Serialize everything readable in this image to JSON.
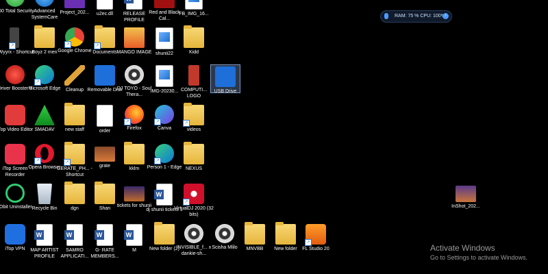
{
  "widget": {
    "text": "RAM: 75 %   CPU: 100%"
  },
  "activation": {
    "title": "Activate Windows",
    "subtitle": "Go to Settings to activate Windows."
  },
  "icons": [
    {
      "label": "360 Total Security"
    },
    {
      "label": "Advanced SystemCare"
    },
    {
      "label": "Project_202..."
    },
    {
      "label": "u2ec.dll"
    },
    {
      "label": "RELEASE PROFILE"
    },
    {
      "label": "Red and Black Cal..."
    },
    {
      "label": "FB_IMG_16..."
    },
    {
      "label": "HWyyrx - Shortcut"
    },
    {
      "label": "Boyz 2 men"
    },
    {
      "label": "Google Chrome"
    },
    {
      "label": "Documents"
    },
    {
      "label": "MANGO IMAGE"
    },
    {
      "label": "shunii22"
    },
    {
      "label": "Kidd"
    },
    {
      "label": "Driver Booster 8"
    },
    {
      "label": "Microsoft Edge"
    },
    {
      "label": "Cleanup"
    },
    {
      "label": "Removable Disk"
    },
    {
      "label": "DJ TOYO - Soul Thera..."
    },
    {
      "label": "IMG-20230..."
    },
    {
      "label": "COMPUTI... LOGO"
    },
    {
      "label": "USB Drive"
    },
    {
      "label": "iTop Video Editor"
    },
    {
      "label": "SMADAV"
    },
    {
      "label": "new staff"
    },
    {
      "label": "order"
    },
    {
      "label": "Firefox"
    },
    {
      "label": "Canva"
    },
    {
      "label": "videos"
    },
    {
      "label": "iTop Screen Recorder"
    },
    {
      "label": "Opera Browser"
    },
    {
      "label": "GERATE_PH... - Shortcut"
    },
    {
      "label": "grate"
    },
    {
      "label": "kklm"
    },
    {
      "label": "Person 1 - Edge"
    },
    {
      "label": "NEXUS"
    },
    {
      "label": "IObit Uninstaller"
    },
    {
      "label": "Recycle Bin"
    },
    {
      "label": "dgn"
    },
    {
      "label": "Shan"
    },
    {
      "label": "tickets for shunii"
    },
    {
      "label": "dj shunii tickets 1"
    },
    {
      "label": "VirtualDJ 2020 (32 bits)"
    },
    {
      "label": "InShot_202..."
    },
    {
      "label": "iTop VPN"
    },
    {
      "label": "MAP ARTIST PROFILE"
    },
    {
      "label": "SAMRO APPLICATI..."
    },
    {
      "label": "G- RATE MEMBERS..."
    },
    {
      "label": "M"
    },
    {
      "label": "New folder (2)"
    },
    {
      "label": "INVISIBLE_f... x dankie-sh..."
    },
    {
      "label": "Scisha Mlilo"
    },
    {
      "label": "MNVBB"
    },
    {
      "label": "New folder"
    },
    {
      "label": "FL Studio 20"
    }
  ]
}
